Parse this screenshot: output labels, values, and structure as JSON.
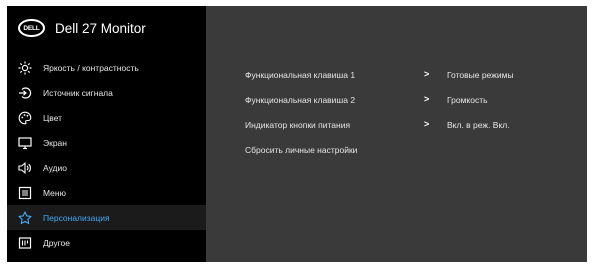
{
  "monitor": {
    "logo_text": "DELL",
    "title": "Dell 27 Monitor"
  },
  "sidebar": {
    "items": [
      {
        "label": "Яркость / контрастность",
        "icon": "brightness-icon"
      },
      {
        "label": "Источник сигнала",
        "icon": "input-source-icon"
      },
      {
        "label": "Цвет",
        "icon": "color-icon"
      },
      {
        "label": "Экран",
        "icon": "display-icon"
      },
      {
        "label": "Аудио",
        "icon": "audio-icon"
      },
      {
        "label": "Меню",
        "icon": "menu-icon"
      },
      {
        "label": "Персонализация",
        "icon": "star-icon",
        "active": true
      },
      {
        "label": "Другое",
        "icon": "other-icon"
      }
    ]
  },
  "content": {
    "rows": [
      {
        "label": "Функциональная клавиша 1",
        "arrow": ">",
        "value": "Готовые режимы"
      },
      {
        "label": "Функциональная клавиша 2",
        "arrow": ">",
        "value": "Громкость"
      },
      {
        "label": "Индикатор кнопки питания",
        "arrow": ">",
        "value": "Вкл. в реж. Вкл."
      },
      {
        "label": "Сбросить личные настройки"
      }
    ]
  },
  "colors": {
    "accent": "#3fa9f5",
    "panel": "#3a3a3a",
    "sidebar": "#000000"
  }
}
